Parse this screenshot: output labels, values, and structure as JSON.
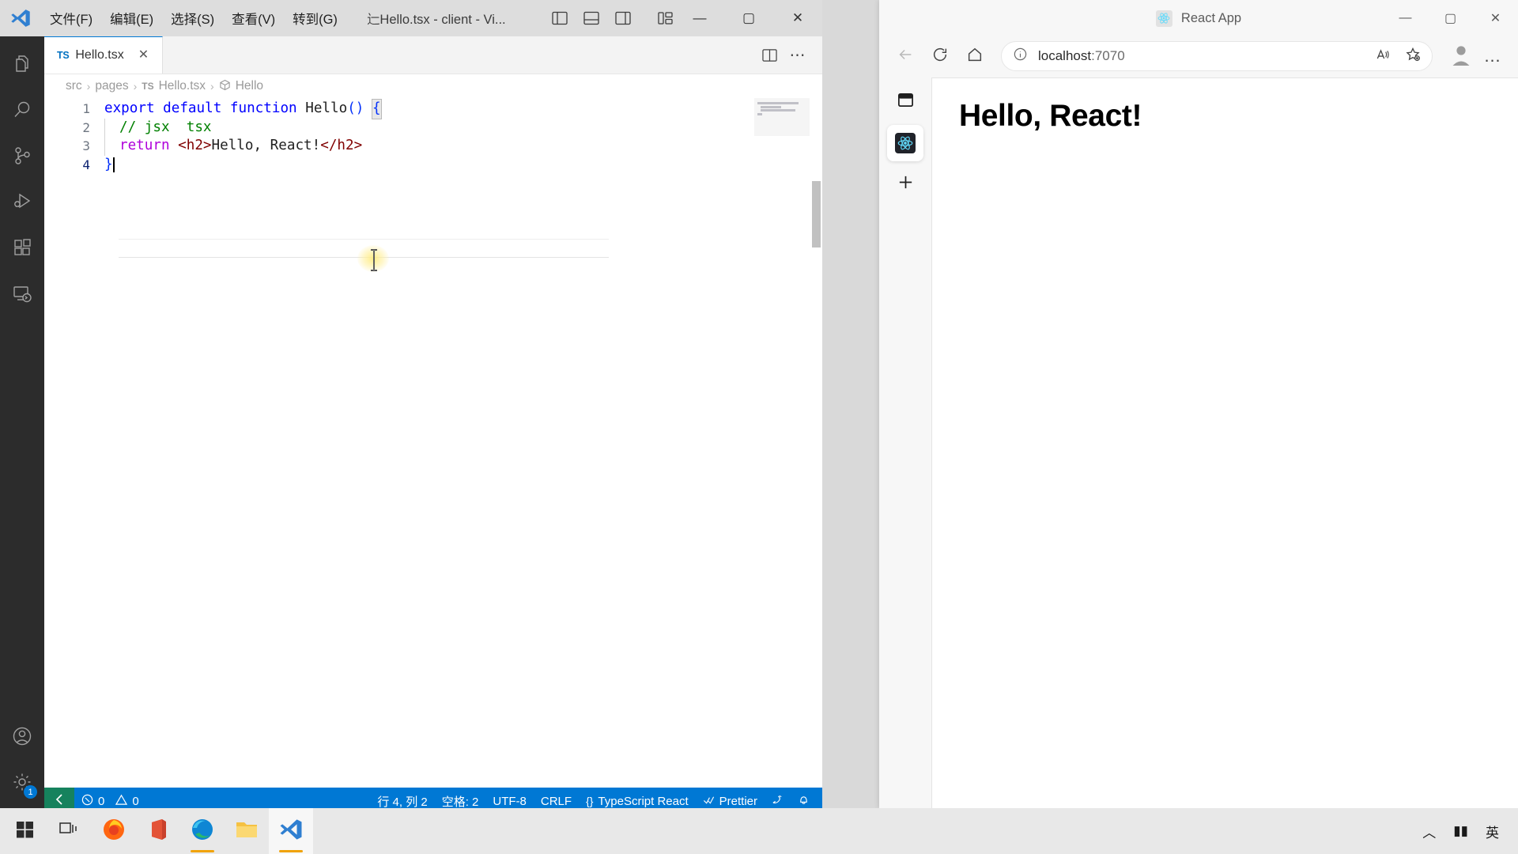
{
  "vscode": {
    "window_title": "辷Hello.tsx - client - Vi...",
    "menu": [
      {
        "label": "文件(F)",
        "name": "menu-file"
      },
      {
        "label": "编辑(E)",
        "name": "menu-edit"
      },
      {
        "label": "选择(S)",
        "name": "menu-selection"
      },
      {
        "label": "查看(V)",
        "name": "menu-view"
      },
      {
        "label": "转到(G)",
        "name": "menu-go"
      }
    ],
    "window_buttons": {
      "minimize": "—",
      "maximize": "▢",
      "close": "✕"
    },
    "activity_bar": [
      {
        "name": "explorer",
        "icon": "files-icon"
      },
      {
        "name": "search",
        "icon": "search-icon"
      },
      {
        "name": "source-control",
        "icon": "source-control-icon"
      },
      {
        "name": "run-debug",
        "icon": "run-debug-icon"
      },
      {
        "name": "extensions",
        "icon": "extensions-icon"
      },
      {
        "name": "remote-explorer",
        "icon": "remote-explorer-icon"
      }
    ],
    "activity_bar_bottom": [
      {
        "name": "accounts",
        "icon": "account-icon",
        "badge": ""
      },
      {
        "name": "manage-settings",
        "icon": "gear-icon",
        "badge": "1"
      }
    ],
    "tab": {
      "badge": "TS",
      "label": "Hello.tsx",
      "close": "✕"
    },
    "breadcrumb": [
      {
        "label": "src",
        "icon": ""
      },
      {
        "label": "pages",
        "icon": ""
      },
      {
        "label": "Hello.tsx",
        "icon": "ts-file-icon"
      },
      {
        "label": "Hello",
        "icon": "symbol-function-icon"
      }
    ],
    "breadcrumb_sep": "›",
    "code_lines": [
      {
        "num": "1",
        "segments": [
          {
            "t": "export ",
            "c": "kw-blue"
          },
          {
            "t": "default ",
            "c": "kw-blue"
          },
          {
            "t": "function ",
            "c": "kw-blue"
          },
          {
            "t": "Hello",
            "c": "ctext"
          },
          {
            "t": "()",
            "c": "brack"
          },
          {
            "t": " ",
            "c": "ctext"
          },
          {
            "t": "{",
            "c": "brack brack-hl"
          }
        ]
      },
      {
        "num": "2",
        "indent": 1,
        "segments": [
          {
            "t": "// jsx  tsx",
            "c": "comment"
          }
        ]
      },
      {
        "num": "3",
        "indent": 1,
        "segments": [
          {
            "t": "return ",
            "c": "kw-purple"
          },
          {
            "t": "<h2>",
            "c": "tag"
          },
          {
            "t": "Hello, React!",
            "c": "ctext"
          },
          {
            "t": "</h2>",
            "c": "tag"
          }
        ]
      },
      {
        "num": "4",
        "active": true,
        "segments": [
          {
            "t": "}",
            "c": "brack"
          }
        ]
      }
    ],
    "statusbar": {
      "remote_icon": "remote-indicator-icon",
      "problems": "0",
      "warnings": "0",
      "cursor_position": "行 4, 列 2",
      "indentation": "空格: 2",
      "encoding": "UTF-8",
      "eol": "CRLF",
      "language": "TypeScript React",
      "formatter": "Prettier",
      "feedback_icon": "tweet-feedback-icon",
      "notifications_icon": "bell-icon"
    }
  },
  "edge": {
    "title": "React App",
    "favicon": "react-favicon",
    "window_buttons": {
      "minimize": "—",
      "maximize": "▢",
      "close": "✕"
    },
    "toolbar": {
      "back": "back-arrow-icon",
      "refresh": "refresh-icon",
      "home": "home-icon",
      "url": "localhost:7070",
      "url_host": "localhost",
      "url_port": ":7070",
      "info_icon": "site-info-icon",
      "read_aloud": "read-aloud-icon",
      "favorite": "add-favorite-icon",
      "profile": "profile-avatar-icon",
      "settings_more": "…"
    },
    "vertical_tabs": [
      {
        "name": "tab-list-toggle",
        "icon": "tab-pane-icon",
        "selected": false
      },
      {
        "name": "tab-react-app",
        "icon": "react-icon",
        "selected": true
      },
      {
        "name": "new-tab-button",
        "icon": "plus-icon",
        "selected": false
      }
    ],
    "page": {
      "heading": "Hello, React!"
    }
  },
  "taskbar": {
    "items": [
      {
        "name": "start-button",
        "icon": "windows-logo-icon",
        "active": false
      },
      {
        "name": "task-view-button",
        "icon": "task-view-icon",
        "active": false
      },
      {
        "name": "taskbar-firefox",
        "icon": "firefox-icon",
        "active": false
      },
      {
        "name": "taskbar-office",
        "icon": "office-icon",
        "active": false
      },
      {
        "name": "taskbar-edge",
        "icon": "edge-icon",
        "active": false,
        "running": true
      },
      {
        "name": "taskbar-explorer",
        "icon": "file-explorer-icon",
        "active": false
      },
      {
        "name": "taskbar-vscode",
        "icon": "vscode-icon",
        "active": true,
        "running": true
      }
    ],
    "tray": [
      {
        "name": "tray-overflow",
        "label": "︿"
      },
      {
        "name": "tray-network",
        "label": "▮▮"
      },
      {
        "name": "tray-ime",
        "label": "英"
      }
    ]
  }
}
